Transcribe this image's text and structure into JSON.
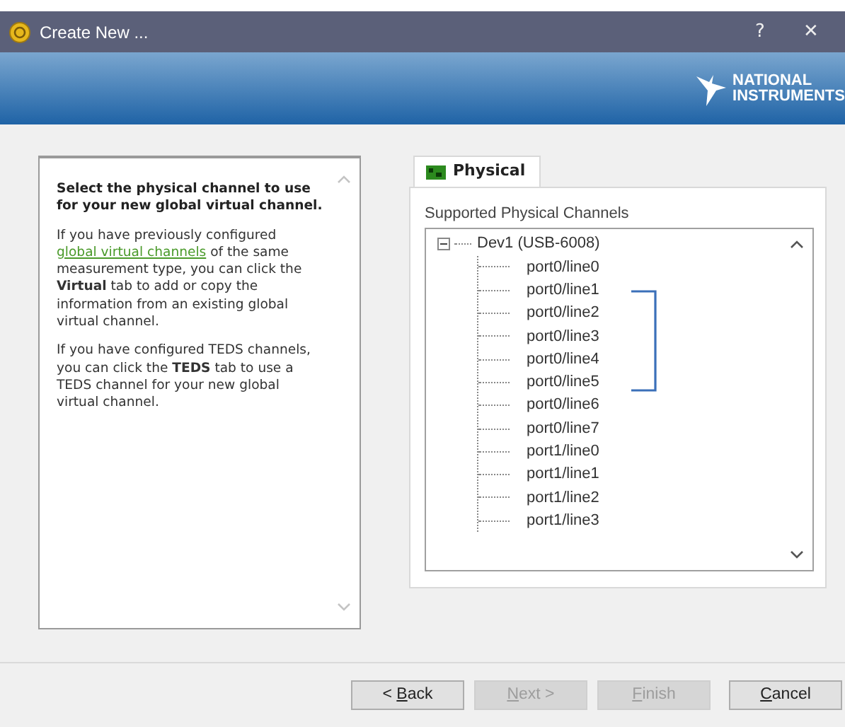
{
  "window": {
    "title": "Create New ...",
    "buttons": [
      "?",
      "✕"
    ]
  },
  "banner": {
    "logo_lines": [
      "NATIONAL",
      "INSTRUMENTS"
    ]
  },
  "help": {
    "heading": "Select the physical channel to use for your new global virtual channel.",
    "paragraphs": [
      {
        "before": "If you have previously configured ",
        "link": "global virtual channels",
        "after": " of the same measurement type, you can click the **Virtual** tab to add or copy the information from an existing global virtual channel."
      },
      {
        "before": "If you have configured TEDS channels, you can click the **TEDS** tab to use a TEDS channel for your new global virtual channel."
      }
    ]
  },
  "tabs": [
    {
      "label": "Physical",
      "selected": true
    }
  ],
  "tree": {
    "label": "Supported Physical Channels",
    "items": [
      {
        "label": "Dev1  (USB-6008)",
        "expanded": true,
        "children": [
          {
            "label": "port0/line0"
          },
          {
            "label": "port0/line1"
          },
          {
            "label": "port0/line2"
          },
          {
            "label": "port0/line3"
          },
          {
            "label": "port0/line4"
          },
          {
            "label": "port0/line5"
          },
          {
            "label": "port0/line6"
          },
          {
            "label": "port0/line7"
          },
          {
            "label": "port1/line0"
          },
          {
            "label": "port1/line1"
          },
          {
            "label": "port1/line2"
          },
          {
            "label": "port1/line3"
          }
        ]
      }
    ]
  },
  "buttons": [
    {
      "before": "< ",
      "access_key": "B",
      "after": "ack",
      "disabled": false
    },
    {
      "access_key": "N",
      "after": "ext >",
      "disabled": true
    },
    {
      "access_key": "F",
      "after": "inish",
      "disabled": true
    },
    {
      "access_key": "C",
      "after": "ancel",
      "disabled": false
    }
  ]
}
